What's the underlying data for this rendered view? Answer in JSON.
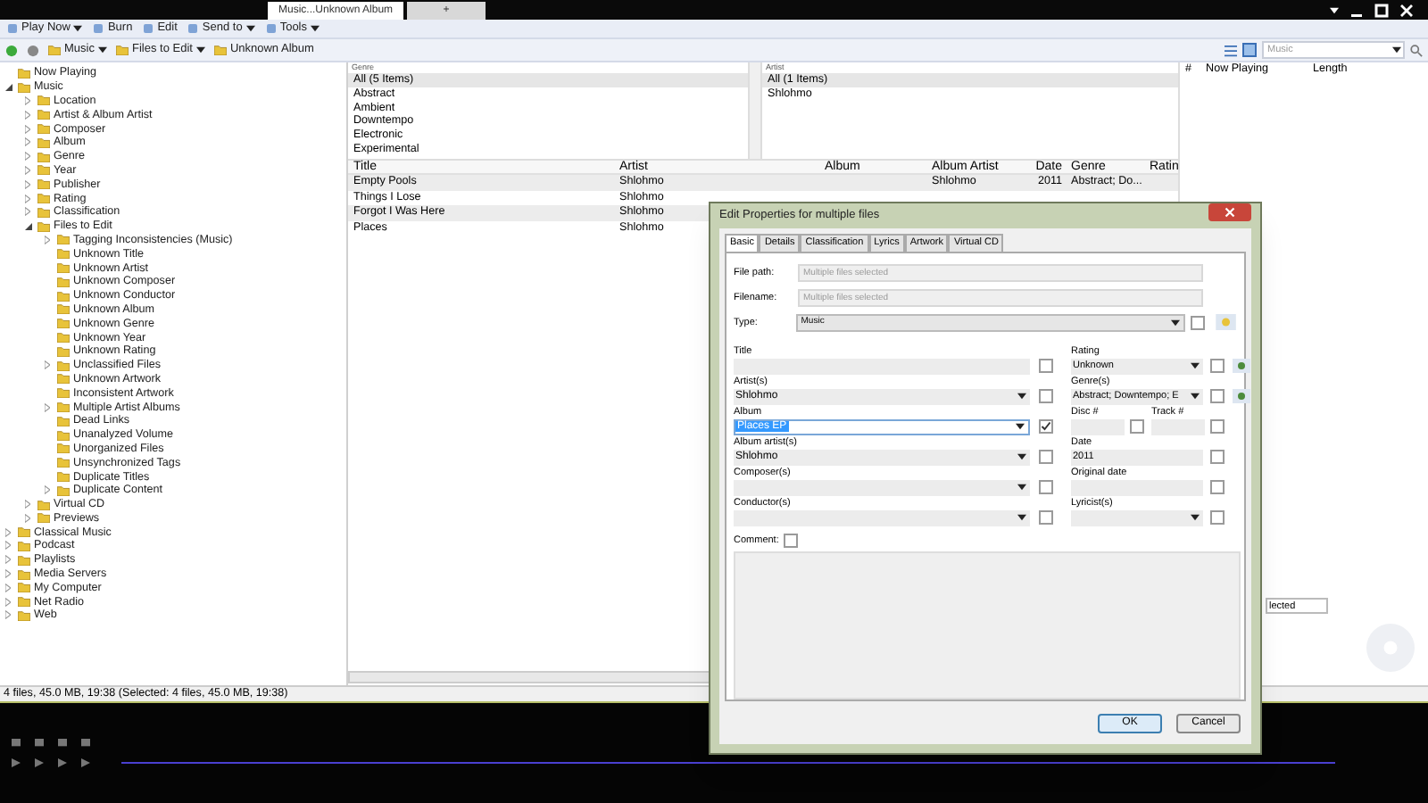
{
  "tabs": [
    {
      "label": "Music...Unknown Album",
      "selected": true
    },
    {
      "label": "+",
      "selected": false
    }
  ],
  "toolbar": [
    {
      "label": "Play Now",
      "menu": true
    },
    {
      "label": "Burn",
      "menu": false
    },
    {
      "label": "Edit",
      "menu": false
    },
    {
      "label": "Send to",
      "menu": true
    },
    {
      "label": "Tools",
      "menu": true
    }
  ],
  "breadcrumb": [
    {
      "label": "Music",
      "menu": true
    },
    {
      "label": "Files to Edit",
      "menu": true
    },
    {
      "label": "Unknown Album",
      "menu": false
    }
  ],
  "search": {
    "placeholder": "Music"
  },
  "tree": [
    {
      "label": "Now Playing",
      "kind": "leaf"
    },
    {
      "label": "Music",
      "kind": "branch",
      "expanded": true,
      "children": [
        {
          "label": "Location",
          "kind": "branch",
          "expanded": false
        },
        {
          "label": "Artist & Album Artist",
          "kind": "branch",
          "expanded": false
        },
        {
          "label": "Composer",
          "kind": "branch",
          "expanded": false
        },
        {
          "label": "Album",
          "kind": "branch",
          "expanded": false
        },
        {
          "label": "Genre",
          "kind": "branch",
          "expanded": false
        },
        {
          "label": "Year",
          "kind": "branch",
          "expanded": false
        },
        {
          "label": "Publisher",
          "kind": "branch",
          "expanded": false
        },
        {
          "label": "Rating",
          "kind": "branch",
          "expanded": false
        },
        {
          "label": "Classification",
          "kind": "branch",
          "expanded": false
        },
        {
          "label": "Files to Edit",
          "kind": "branch",
          "expanded": true,
          "children": [
            {
              "label": "Tagging Inconsistencies (Music)",
              "kind": "branch",
              "expanded": false
            },
            {
              "label": "Unknown Title",
              "kind": "leaf"
            },
            {
              "label": "Unknown Artist",
              "kind": "leaf"
            },
            {
              "label": "Unknown Composer",
              "kind": "leaf"
            },
            {
              "label": "Unknown Conductor",
              "kind": "leaf"
            },
            {
              "label": "Unknown Album",
              "kind": "leaf"
            },
            {
              "label": "Unknown Genre",
              "kind": "leaf"
            },
            {
              "label": "Unknown Year",
              "kind": "leaf"
            },
            {
              "label": "Unknown Rating",
              "kind": "leaf"
            },
            {
              "label": "Unclassified Files",
              "kind": "branch",
              "expanded": false
            },
            {
              "label": "Unknown Artwork",
              "kind": "leaf"
            },
            {
              "label": "Inconsistent Artwork",
              "kind": "leaf"
            },
            {
              "label": "Multiple Artist Albums",
              "kind": "branch",
              "expanded": false
            },
            {
              "label": "Dead Links",
              "kind": "leaf"
            },
            {
              "label": "Unanalyzed Volume",
              "kind": "leaf"
            },
            {
              "label": "Unorganized Files",
              "kind": "leaf"
            },
            {
              "label": "Unsynchronized Tags",
              "kind": "leaf"
            },
            {
              "label": "Duplicate Titles",
              "kind": "leaf"
            },
            {
              "label": "Duplicate Content",
              "kind": "branch",
              "expanded": false
            }
          ]
        },
        {
          "label": "Virtual CD",
          "kind": "branch",
          "expanded": false
        },
        {
          "label": "Previews",
          "kind": "branch",
          "expanded": false
        }
      ]
    },
    {
      "label": "Classical Music",
      "kind": "branch",
      "expanded": false
    },
    {
      "label": "Podcast",
      "kind": "branch",
      "expanded": false
    },
    {
      "label": "Playlists",
      "kind": "branch",
      "expanded": false
    },
    {
      "label": "Media Servers",
      "kind": "branch",
      "expanded": false
    },
    {
      "label": "My Computer",
      "kind": "branch",
      "expanded": false
    },
    {
      "label": "Net Radio",
      "kind": "branch",
      "expanded": false
    },
    {
      "label": "Web",
      "kind": "branch",
      "expanded": false
    }
  ],
  "genre_filter": {
    "heading": "Genre",
    "items": [
      {
        "label": "All (5 Items)",
        "selected": true
      },
      {
        "label": "Abstract",
        "selected": false
      },
      {
        "label": "Ambient",
        "selected": false
      },
      {
        "label": "Downtempo",
        "selected": false
      },
      {
        "label": "Electronic",
        "selected": false
      },
      {
        "label": "Experimental",
        "selected": false
      }
    ]
  },
  "artist_filter": {
    "heading": "Artist",
    "items": [
      {
        "label": "All (1 Items)",
        "selected": true
      },
      {
        "label": "Shlohmo",
        "selected": false
      }
    ]
  },
  "now_playing": {
    "columns": [
      "#",
      "Now Playing",
      "Length"
    ],
    "field_value": "lected"
  },
  "tracks": {
    "columns": [
      "Title",
      "Artist",
      "Album",
      "Album Artist",
      "Date",
      "Genre",
      "Ratin"
    ],
    "rows": [
      [
        "Empty Pools",
        "Shlohmo",
        "",
        "Shlohmo",
        "2011",
        "Abstract; Do..."
      ],
      [
        "Things I Lose",
        "Shlohmo"
      ],
      [
        "Forgot I Was Here",
        "Shlohmo"
      ],
      [
        "Places",
        "Shlohmo"
      ]
    ]
  },
  "status_bar": "4 files, 45.0 MB, 19:38 (Selected: 4 files, 45.0 MB, 19:38)",
  "dialog": {
    "title": "Edit Properties for multiple files",
    "tabs": [
      {
        "label": "Basic",
        "selected": true
      },
      {
        "label": "Details",
        "selected": false
      },
      {
        "label": "Classification",
        "selected": false
      },
      {
        "label": "Lyrics",
        "selected": false
      },
      {
        "label": "Artwork",
        "selected": false
      },
      {
        "label": "Virtual CD",
        "selected": false
      }
    ],
    "file_path": {
      "label": "File path:",
      "placeholder": "Multiple files selected"
    },
    "filename": {
      "label": "Filename:",
      "placeholder": "Multiple files selected"
    },
    "type": {
      "label": "Type:",
      "value": "Music",
      "checked": false
    },
    "left_fields": [
      {
        "label": "Title",
        "kind": "text",
        "checked": false,
        "selected": false
      },
      {
        "label": "Artist(s)",
        "value": "Shlohmo",
        "kind": "dropdown",
        "checked": false,
        "selected": false
      },
      {
        "label": "Album",
        "value": "Places EP",
        "kind": "dropdown",
        "checked": true,
        "selected": true
      },
      {
        "label": "Album artist(s)",
        "value": "Shlohmo",
        "kind": "dropdown",
        "checked": false,
        "selected": false
      },
      {
        "label": "Composer(s)",
        "kind": "dropdown",
        "checked": false,
        "selected": false
      },
      {
        "label": "Conductor(s)",
        "kind": "dropdown",
        "checked": false,
        "selected": false
      }
    ],
    "right_fields": [
      {
        "label": "Rating",
        "value": "Unknown",
        "kind": "dropdown",
        "checked": false,
        "side_button": true
      },
      {
        "label": "Genre(s)",
        "value": "Abstract; Downtempo; E",
        "kind": "dropdown",
        "checked": false,
        "side_button": true
      },
      {
        "kind": "pair",
        "parts": [
          {
            "label": "Disc #",
            "checked": false
          },
          {
            "label": "Track #",
            "checked": false
          }
        ]
      },
      {
        "label": "Date",
        "value": "2011",
        "kind": "text",
        "checked": false,
        "side_button": false
      },
      {
        "label": "Original date",
        "kind": "text",
        "checked": false,
        "side_button": false
      },
      {
        "label": "Lyricist(s)",
        "kind": "dropdown",
        "checked": false,
        "side_button": false
      }
    ],
    "comment": {
      "label": "Comment:",
      "checked": false
    },
    "buttons": [
      {
        "label": "OK",
        "kind": "default"
      },
      {
        "label": "Cancel",
        "kind": "normal"
      }
    ]
  }
}
